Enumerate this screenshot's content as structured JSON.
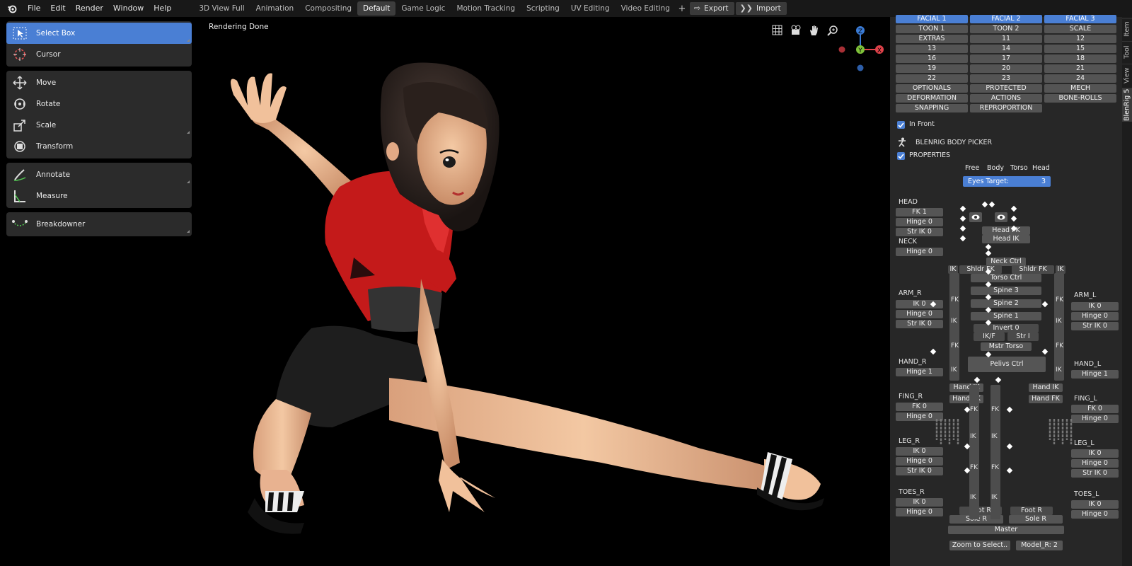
{
  "menu": [
    "File",
    "Edit",
    "Render",
    "Window",
    "Help"
  ],
  "workspaces": [
    "3D View Full",
    "Animation",
    "Compositing",
    "Default",
    "Game Logic",
    "Motion Tracking",
    "Scripting",
    "UV Editing",
    "Video Editing"
  ],
  "active_workspace": "Default",
  "topbar": {
    "export": "Export",
    "import": "Import"
  },
  "tools": {
    "select_box": "Select Box",
    "cursor": "Cursor",
    "move": "Move",
    "rotate": "Rotate",
    "scale": "Scale",
    "transform": "Transform",
    "annotate": "Annotate",
    "measure": "Measure",
    "breakdowner": "Breakdowner"
  },
  "viewport": {
    "status": "Rendering Done"
  },
  "gizmo": {
    "z": "Z",
    "y": "Y",
    "x": "X"
  },
  "layers": [
    [
      "FACIAL 1",
      "FACIAL 2",
      "FACIAL 3"
    ],
    [
      "TOON 1",
      "TOON 2",
      "SCALE"
    ],
    [
      "EXTRAS",
      "11",
      "12"
    ],
    [
      "13",
      "14",
      "15"
    ],
    [
      "16",
      "17",
      "18"
    ],
    [
      "19",
      "20",
      "21"
    ],
    [
      "22",
      "23",
      "24"
    ],
    [
      "OPTIONALS",
      "PROTECTED",
      "MECH"
    ],
    [
      "DEFORMATION",
      "ACTIONS",
      "BONE-ROLLS"
    ],
    [
      "SNAPPING",
      "REPROPORTION",
      ""
    ]
  ],
  "panel": {
    "in_front": "In Front",
    "body_picker": "BLENRIG BODY PICKER",
    "properties": "PROPERTIES",
    "tabs": [
      "Free",
      "Body",
      "Torso",
      "Head"
    ],
    "eyes_target_label": "Eyes Target:",
    "eyes_target_value": "3"
  },
  "left_props": {
    "head": "HEAD",
    "head_fk": "FK 1",
    "head_hinge": "Hinge 0",
    "head_str": "Str IK 0",
    "neck": "NECK",
    "neck_hinge": "Hinge 0",
    "arm_r": "ARM_R",
    "arm_r_ik": "IK 0",
    "arm_r_hinge": "Hinge 0",
    "arm_r_str": "Str IK 0",
    "hand_r": "HAND_R",
    "hand_r_hinge": "Hinge 1",
    "fing_r": "FING_R",
    "fing_r_fk": "FK 0",
    "fing_r_hinge": "Hinge 0",
    "leg_r": "LEG_R",
    "leg_r_ik": "IK 0",
    "leg_r_hinge": "Hinge 0",
    "leg_r_str": "Str IK 0",
    "toes_r": "TOES_R",
    "toes_r_ik": "IK 0",
    "toes_r_hinge": "Hinge 0"
  },
  "right_props": {
    "arm_l": "ARM_L",
    "arm_l_ik": "IK 0",
    "arm_l_hinge": "Hinge 0",
    "arm_l_str": "Str IK 0",
    "hand_l": "HAND_L",
    "hand_l_hinge": "Hinge 1",
    "fing_l": "FING_L",
    "fing_l_fk": "FK 0",
    "fing_l_hinge": "Hinge 0",
    "leg_l": "LEG_L",
    "leg_l_ik": "IK 0",
    "leg_l_hinge": "Hinge 0",
    "leg_l_str": "Str IK 0",
    "toes_l": "TOES_L",
    "toes_l_ik": "IK 0",
    "toes_l_hinge": "Hinge 0"
  },
  "picker": {
    "head_fk": "Head FK",
    "head_ik": "Head IK",
    "neck_ctrl": "Neck Ctrl",
    "ik": "IK",
    "shldr_fk": "Shldr FK",
    "torso_ctrl": "Torso Ctrl",
    "spine3": "Spine 3",
    "spine2": "Spine 2",
    "spine1": "Spine 1",
    "fk": "FK",
    "invert": "Invert 0",
    "ikf": "IK/F",
    "str_i": "Str I",
    "mstr_torso": "Mstr Torso",
    "pelvis_ctrl": "Pelivs Ctrl",
    "hand_ik": "Hand IK",
    "hand_fk": "Hand FK",
    "foot_r": "Foot R",
    "sole_r": "Sole R",
    "master": "Master",
    "zoom": "Zoom to Select..",
    "model": "Model_R: 2"
  },
  "sidetabs": [
    "Item",
    "Tool",
    "View",
    "BlenRig 5"
  ],
  "colors": {
    "accent": "#4a7fd4",
    "panel": "#272727",
    "button": "#545454",
    "topbar": "#181818"
  }
}
